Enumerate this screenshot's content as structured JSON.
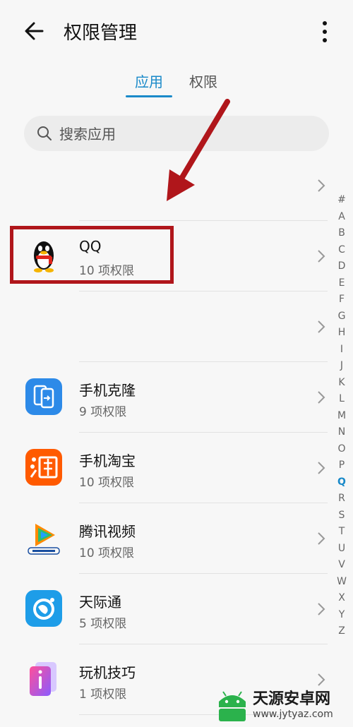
{
  "header": {
    "title": "权限管理"
  },
  "tabs": [
    {
      "label": "应用",
      "active": true
    },
    {
      "label": "权限",
      "active": false
    }
  ],
  "search": {
    "placeholder": "搜索应用"
  },
  "apps": [
    {
      "name": "",
      "sub": "",
      "icon": "none"
    },
    {
      "name": "QQ",
      "sub": "10 项权限",
      "icon": "qq-penguin-icon"
    },
    {
      "name": "",
      "sub": "",
      "icon": "none"
    },
    {
      "name": "手机克隆",
      "sub": "9 项权限",
      "icon": "phone-clone-icon"
    },
    {
      "name": "手机淘宝",
      "sub": "10 项权限",
      "icon": "taobao-icon"
    },
    {
      "name": "腾讯视频",
      "sub": "10 项权限",
      "icon": "tencent-video-icon"
    },
    {
      "name": "天际通",
      "sub": "5 项权限",
      "icon": "tianjitong-icon"
    },
    {
      "name": "玩机技巧",
      "sub": "1 项权限",
      "icon": "tips-icon"
    }
  ],
  "index": [
    "#",
    "A",
    "B",
    "C",
    "D",
    "E",
    "F",
    "G",
    "H",
    "I",
    "J",
    "K",
    "L",
    "M",
    "N",
    "O",
    "P",
    "Q",
    "R",
    "S",
    "T",
    "U",
    "V",
    "W",
    "X",
    "Y",
    "Z"
  ],
  "index_active": "Q",
  "watermark": {
    "title": "天源安卓网",
    "url": "www.jytyaz.com"
  },
  "colors": {
    "accent": "#1a8ac9",
    "highlight": "#b0161b"
  }
}
